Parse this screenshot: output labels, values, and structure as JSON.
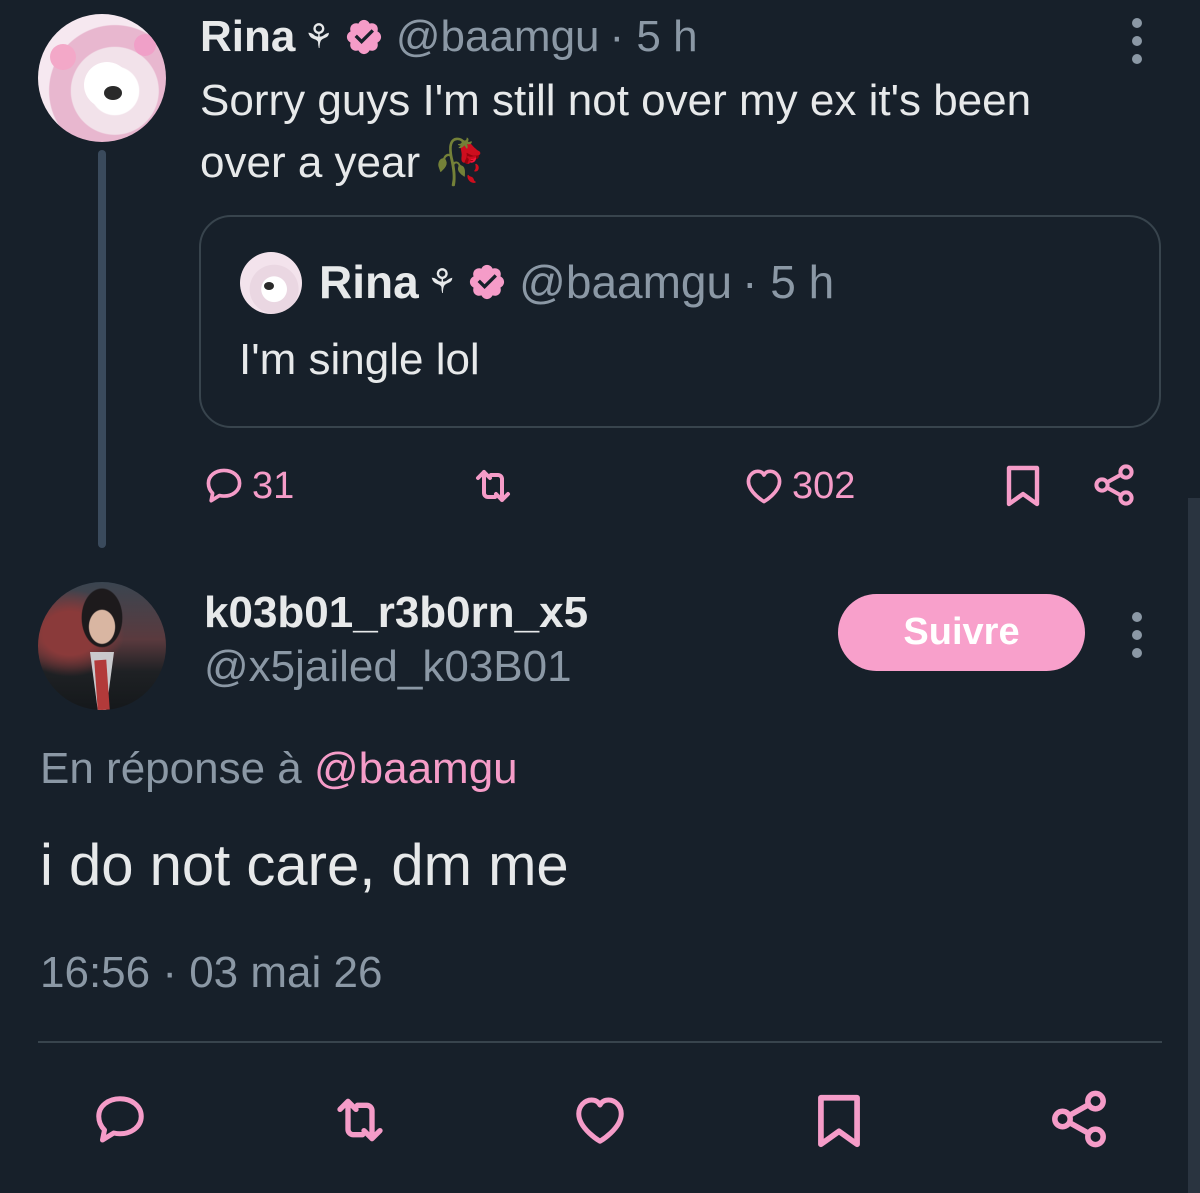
{
  "colors": {
    "background": "#17202a",
    "accent": "#f59cc8",
    "secondary_text": "#8b98a5",
    "verified_badge": "#f59cc8"
  },
  "parent_tweet": {
    "author_name": "Rina",
    "name_glyph": "⚘",
    "handle": "@baamgu",
    "time": "· 5 h",
    "text_line1": "Sorry guys I'm still not over my ex it's been",
    "text_line2": "over a year 🥀",
    "quote": {
      "author_name": "Rina",
      "name_glyph": "⚘",
      "handle": "@baamgu",
      "time": "· 5 h",
      "text": "I'm single lol"
    },
    "actions": {
      "reply_count": "31",
      "like_count": "302"
    }
  },
  "reply_tweet": {
    "author_name": "k03b01_r3b0rn_x5",
    "handle": "@x5jailed_k03B01",
    "follow_label": "Suivre",
    "reply_prefix": "En réponse à ",
    "reply_mention": "@baamgu",
    "text": "i do not care, dm me",
    "timestamp": "16:56 · 03 mai 26"
  },
  "icons": [
    "more-vertical-icon",
    "verified-badge-icon",
    "reply-icon",
    "retweet-icon",
    "like-icon",
    "bookmark-icon",
    "share-icon"
  ]
}
